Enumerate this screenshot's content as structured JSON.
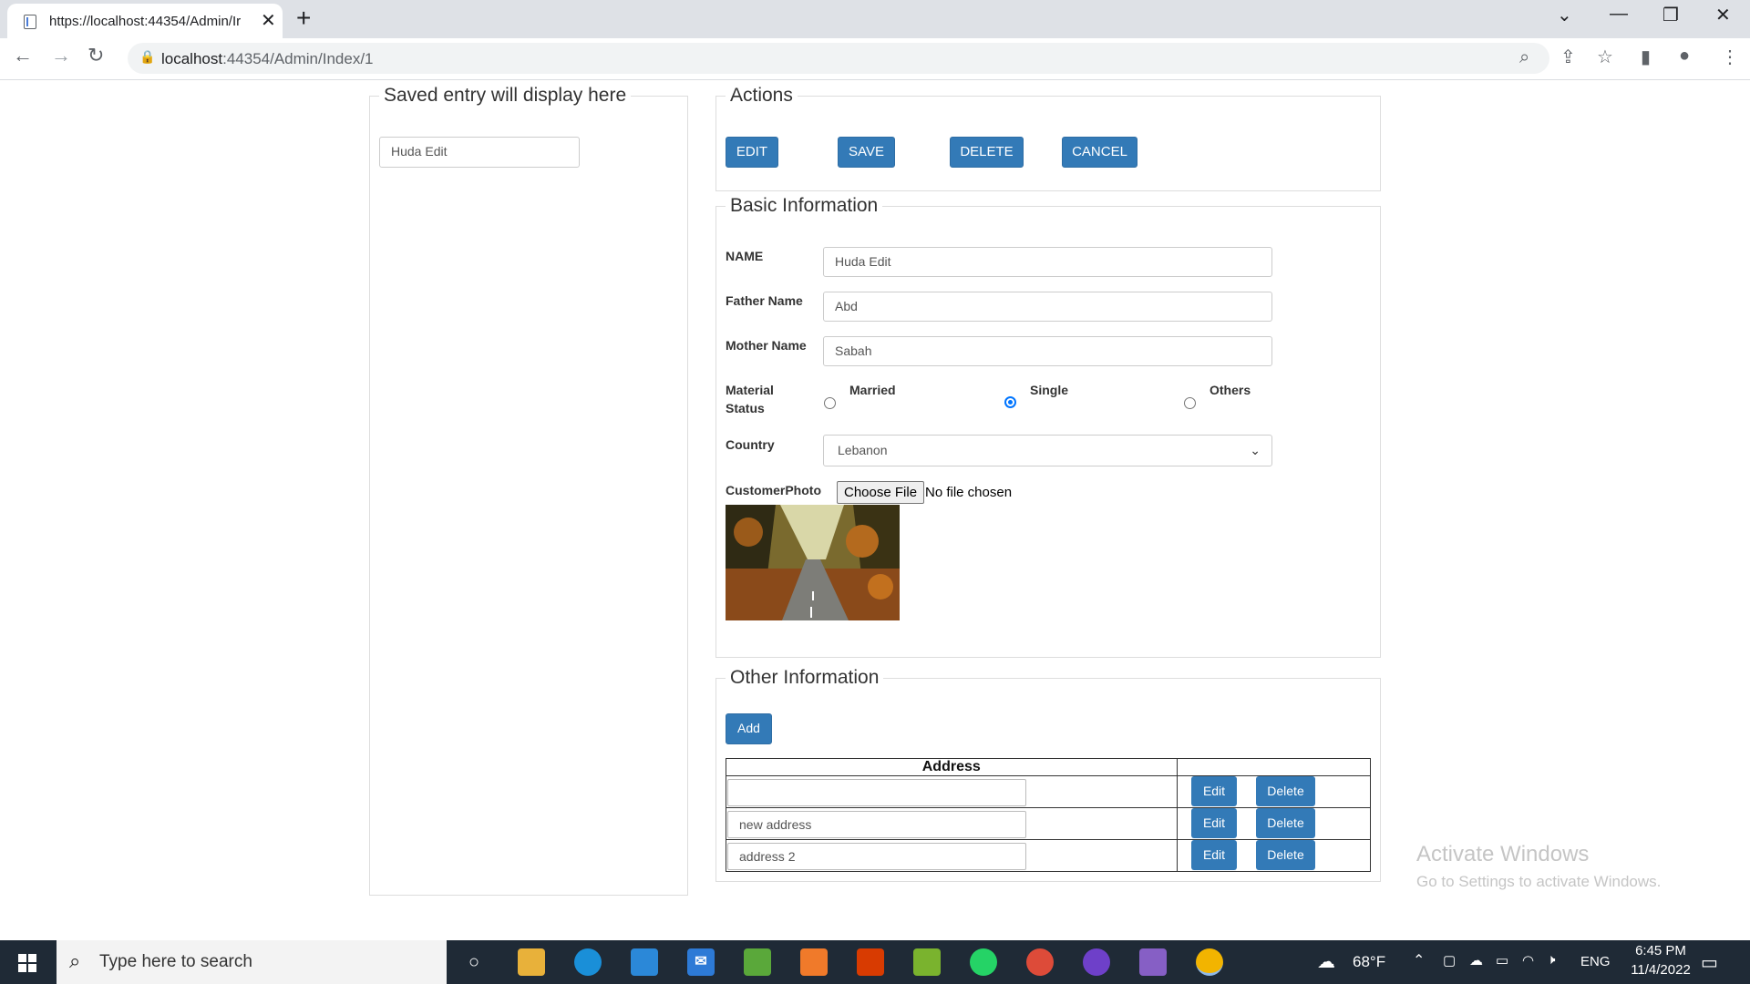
{
  "browser": {
    "tab_title": "https://localhost:44354/Admin/Ir",
    "url_host": "localhost",
    "url_rest": ":44354/Admin/Index/1"
  },
  "saved": {
    "legend": "Saved entry will display here",
    "entry": "Huda Edit"
  },
  "actions": {
    "legend": "Actions",
    "edit": "EDIT",
    "save": "SAVE",
    "delete": "DELETE",
    "cancel": "CANCEL"
  },
  "basic": {
    "legend": "Basic Information",
    "name_label": "NAME",
    "name_value": "Huda Edit",
    "father_label": "Father Name",
    "father_value": "Abd",
    "mother_label": "Mother Name",
    "mother_value": "Sabah",
    "status_label": "Material Status",
    "status_options": [
      "Married",
      "Single",
      "Others"
    ],
    "status_selected": "Single",
    "country_label": "Country",
    "country_value": "Lebanon",
    "photo_label": "CustomerPhoto",
    "choose_file": "Choose File",
    "no_file": "No file chosen"
  },
  "other": {
    "legend": "Other Information",
    "add": "Add",
    "table_header": "Address",
    "rows": [
      {
        "address": "",
        "edit": "Edit",
        "delete": "Delete"
      },
      {
        "address": "new address",
        "edit": "Edit",
        "delete": "Delete"
      },
      {
        "address": "address 2",
        "edit": "Edit",
        "delete": "Delete"
      }
    ]
  },
  "watermark": {
    "line1": "Activate Windows",
    "line2": "Go to Settings to activate Windows."
  },
  "taskbar": {
    "search_placeholder": "Type here to search",
    "weather": "68°F",
    "language": "ENG",
    "time": "6:45 PM",
    "date": "11/4/2022"
  },
  "colors": {
    "primary_button": "#337ab7",
    "taskbar": "#1f2a36",
    "radio_checked": "#0075ff"
  }
}
